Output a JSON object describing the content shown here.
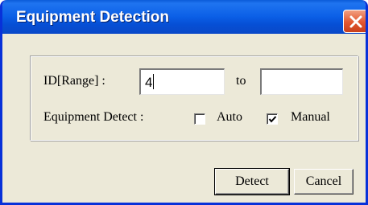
{
  "window": {
    "title": "Equipment Detection"
  },
  "form": {
    "id_range_label": "ID[Range] :",
    "id_from_value": "4",
    "to_label": "to",
    "id_to_value": "",
    "equipment_detect_label": "Equipment Detect :",
    "auto": {
      "label": "Auto",
      "checked": false
    },
    "manual": {
      "label": "Manual",
      "checked": true
    }
  },
  "buttons": {
    "detect_label": "Detect",
    "cancel_label": "Cancel"
  },
  "colors": {
    "titlebar": "#0b5fe6",
    "close_button": "#e2562f",
    "dialog_face": "#ece9d8"
  },
  "icons": {
    "close": "close-icon",
    "checkmark": "checkmark-icon"
  }
}
